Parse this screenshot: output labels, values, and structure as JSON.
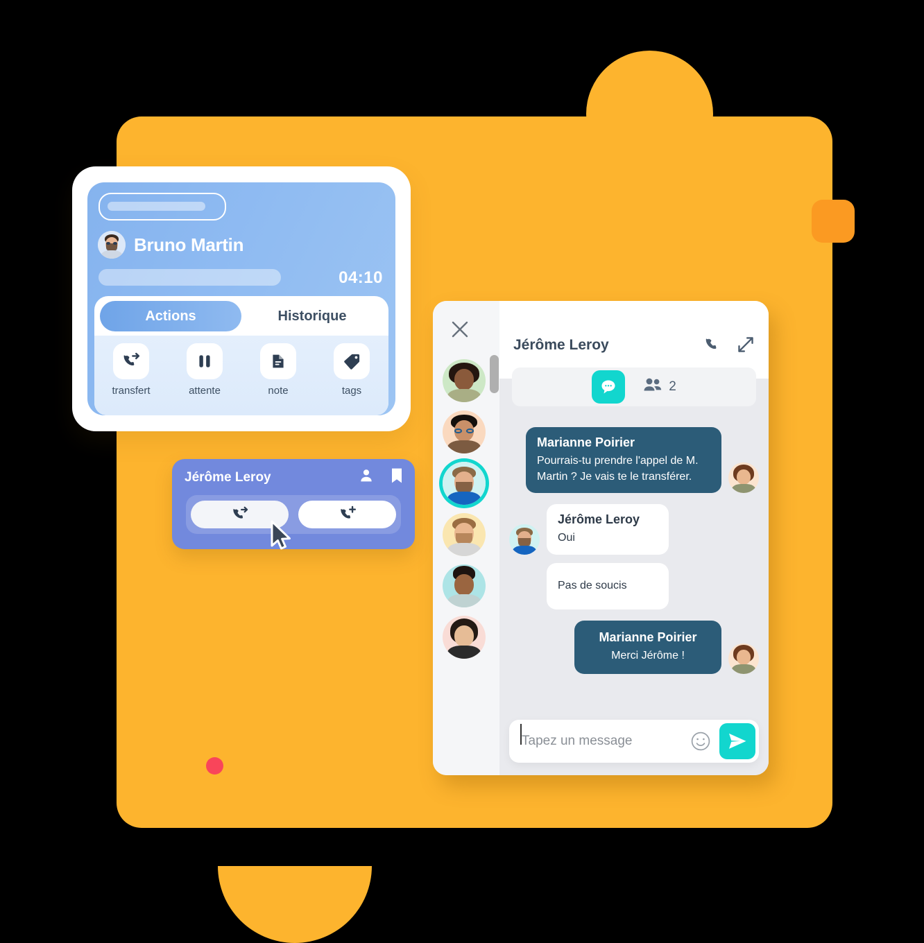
{
  "theme": {
    "bg_orange": "#FDB42E",
    "bg_orange_dark": "#FB9A22",
    "accent_teal": "#12D6CE",
    "bubble_dark": "#2C5C78",
    "card_blue": "#8FBBF2",
    "mini_card_blue": "#7289DD",
    "dot_pink": "#F9455A"
  },
  "call_card": {
    "caller_name": "Bruno Martin",
    "timer": "04:10",
    "tabs": [
      {
        "label": "Actions",
        "active": true
      },
      {
        "label": "Historique",
        "active": false
      }
    ],
    "actions": [
      {
        "label": "transfert",
        "icon": "phone-forward-icon"
      },
      {
        "label": "attente",
        "icon": "pause-icon"
      },
      {
        "label": "note",
        "icon": "document-icon"
      },
      {
        "label": "tags",
        "icon": "tag-icon"
      }
    ]
  },
  "mini_card": {
    "name": "Jérôme Leroy",
    "icons": [
      {
        "name": "person-icon"
      },
      {
        "name": "bookmark-icon"
      }
    ],
    "buttons": [
      {
        "name": "transfer-call-button",
        "icon": "phone-forward-icon",
        "pressed": true
      },
      {
        "name": "add-call-button",
        "icon": "phone-add-icon",
        "pressed": false
      }
    ]
  },
  "chat": {
    "close_icon": "close-icon",
    "title": "Jérôme Leroy",
    "header_icons": [
      {
        "name": "phone-icon"
      },
      {
        "name": "expand-icon"
      }
    ],
    "modes": {
      "chat_icon": "chat-bubble-icon",
      "people_icon": "people-icon",
      "people_count": "2"
    },
    "sidebar_avatars": [
      {
        "name": "avatar-1",
        "bg": "#CDE8C6",
        "selected": false
      },
      {
        "name": "avatar-2",
        "bg": "#FAD9BF",
        "selected": false
      },
      {
        "name": "avatar-3",
        "bg": "#CFF2F2",
        "selected": true
      },
      {
        "name": "avatar-4",
        "bg": "#FAE6B0",
        "selected": false
      },
      {
        "name": "avatar-5",
        "bg": "#ADE4E6",
        "selected": false
      },
      {
        "name": "avatar-6",
        "bg": "#F9DCD6",
        "selected": false
      }
    ],
    "messages": [
      {
        "id": "m1",
        "side": "right",
        "style": "dark",
        "author": "Marianne Poirier",
        "text": "Pourrais-tu prendre l'appel de M. Martin ? Je vais te le transférer.",
        "avatar_bg": "#FBE4CF"
      },
      {
        "id": "m2",
        "side": "left",
        "style": "light",
        "author": "Jérôme Leroy",
        "text": "Oui",
        "avatar_bg": "#CFF2F2"
      },
      {
        "id": "m3",
        "side": "left",
        "style": "light",
        "author": "",
        "text": "Pas de soucis",
        "avatar_bg": ""
      },
      {
        "id": "m4",
        "side": "right",
        "style": "dark",
        "author": "Marianne Poirier",
        "text": "Merci Jérôme !",
        "avatar_bg": "#FBE4CF"
      }
    ],
    "composer": {
      "placeholder": "Tapez un message",
      "value": "",
      "emoji_icon": "smiley-icon",
      "send_icon": "send-icon"
    }
  }
}
